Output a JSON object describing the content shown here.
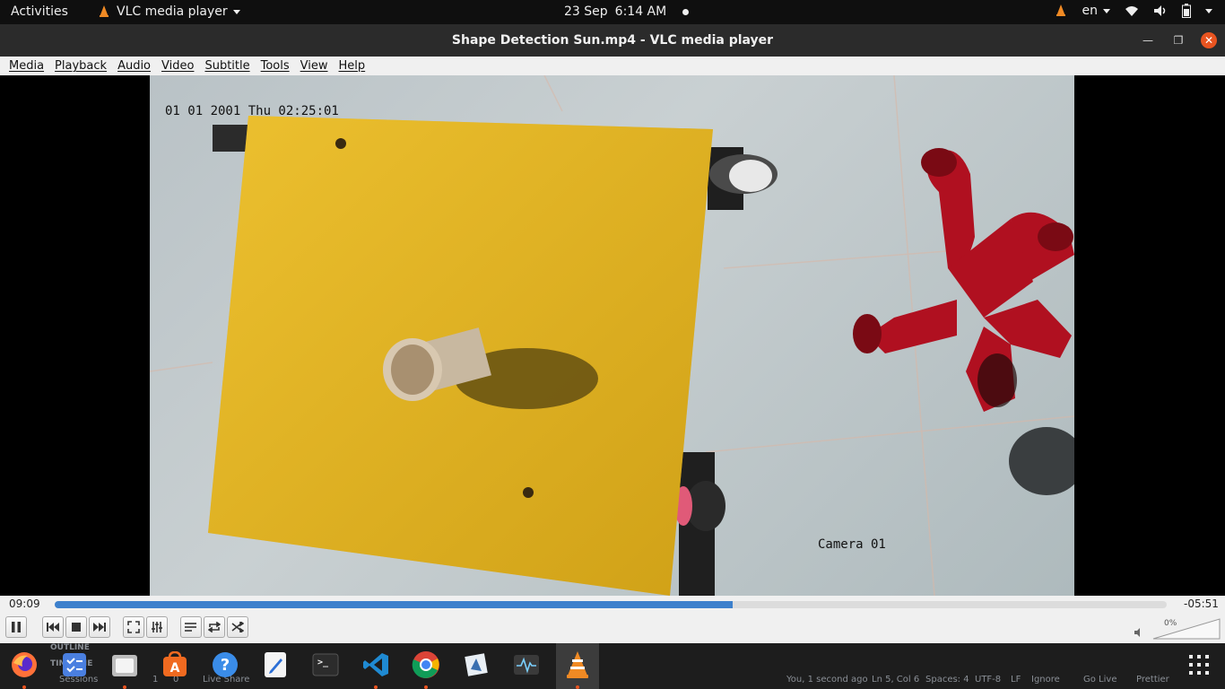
{
  "topbar": {
    "activities": "Activities",
    "app_name": "VLC media player",
    "date": "23 Sep",
    "time": "6:14 AM",
    "language": "en"
  },
  "window": {
    "title": "Shape Detection Sun.mp4 - VLC media player"
  },
  "menu": [
    "Media",
    "Playback",
    "Audio",
    "Video",
    "Subtitle",
    "Tools",
    "View",
    "Help"
  ],
  "video": {
    "timestamp_overlay": "01 01 2001 Thu 02:25:01",
    "camera_overlay": "Camera 01"
  },
  "player": {
    "elapsed": "09:09",
    "remaining": "-05:51",
    "progress": 0.61,
    "volume": "0%"
  },
  "dock": {
    "apps": [
      "firefox-icon",
      "todo-icon",
      "files-icon",
      "software-icon",
      "help-icon",
      "text-editor-icon",
      "terminal-icon",
      "vscode-icon",
      "chrome-icon",
      "screenshot-icon",
      "system-monitor-icon",
      "vlc-icon",
      "app-grid-icon"
    ],
    "ghost_outline": "OUTLINE",
    "ghost_timeline": "TIMELINE",
    "status": {
      "sessions": "Sessions",
      "errors": "1",
      "warnings": "0",
      "live_share": "Live Share",
      "blame": "You, 1 second ago",
      "position": "Ln 5, Col 6",
      "spaces": "Spaces: 4",
      "encoding": "UTF-8",
      "eol": "LF",
      "ignore": "Ignore",
      "go_live": "Go Live",
      "prettier": "Prettier"
    }
  },
  "colors": {
    "seek_fill": "#3d80cc",
    "ubuntu_orange": "#e95420"
  }
}
